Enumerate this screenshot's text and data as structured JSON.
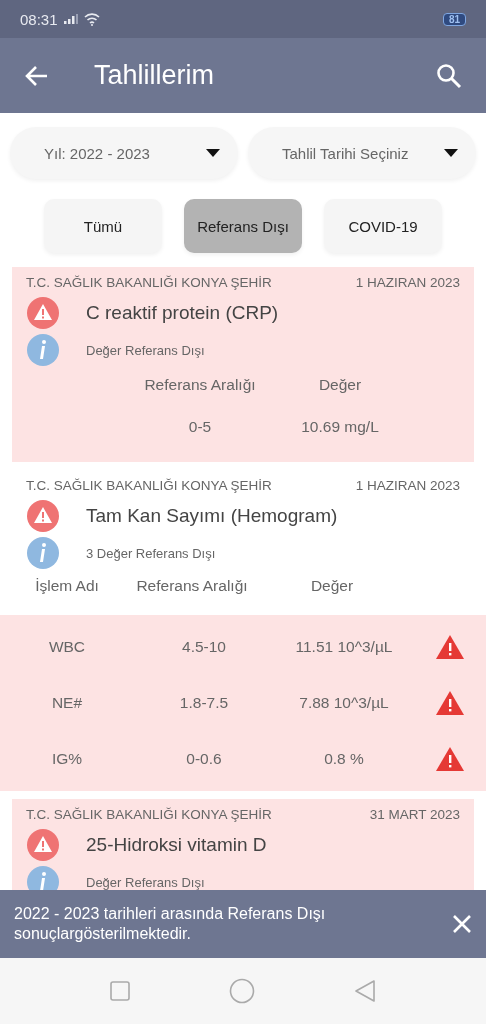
{
  "status_bar": {
    "time": "08:31",
    "battery": "81"
  },
  "app_bar": {
    "title": "Tahlillerim"
  },
  "filters": [
    {
      "label": "Yıl: 2022 - 2023"
    },
    {
      "label": "Tahlil Tarihi Seçiniz"
    }
  ],
  "tabs": [
    {
      "label": "Tümü",
      "selected": false
    },
    {
      "label": "Referans Dışı",
      "selected": true
    },
    {
      "label": "COVID-19",
      "selected": false
    }
  ],
  "results": [
    {
      "kind": "single",
      "highlighted": true,
      "hospital": "T.C. SAĞLIK BAKANLIĞI KONYA ŞEHİR",
      "date": "1 HAZIRAN 2023",
      "test": "C reaktif protein (CRP)",
      "note": "Değer Referans Dışı",
      "columns": [
        "Referans Aralığı",
        "Değer"
      ],
      "range": "0-5",
      "value": "10.69 mg/L"
    },
    {
      "kind": "multi",
      "highlighted": false,
      "hospital": "T.C. SAĞLIK BAKANLIĞI KONYA ŞEHİR",
      "date": "1 HAZIRAN 2023",
      "test": "Tam Kan Sayımı (Hemogram)",
      "note": "3 Değer Referans Dışı",
      "columns": [
        "İşlem Adı",
        "Referans Aralığı",
        "Değer"
      ],
      "rows": [
        {
          "name": "WBC",
          "range": "4.5-10",
          "value": "11.51 10^3/µL",
          "out_of_range": true
        },
        {
          "name": "NE#",
          "range": "1.8-7.5",
          "value": "7.88 10^3/µL",
          "out_of_range": true
        },
        {
          "name": "IG%",
          "range": "0-0.6",
          "value": "0.8 %",
          "out_of_range": true
        }
      ]
    },
    {
      "kind": "partial",
      "highlighted": true,
      "hospital": "T.C. SAĞLIK BAKANLIĞI KONYA ŞEHİR",
      "date": "31 MART 2023",
      "test": "25-Hidroksi vitamin D",
      "note": "Değer Referans Dışı"
    }
  ],
  "snackbar": {
    "message": "2022 - 2023 tarihleri arasında Referans Dışı sonuçlargösterilmektedir."
  }
}
